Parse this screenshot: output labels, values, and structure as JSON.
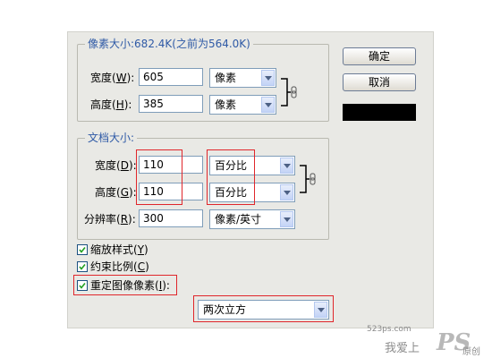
{
  "pixel_dimensions": {
    "title": "像素大小:682.4K(之前为564.0K)",
    "width": {
      "label_pre": "宽度(",
      "accel": "W",
      "label_post": "):",
      "value": "605",
      "unit": "像素"
    },
    "height": {
      "label_pre": "高度(",
      "accel": "H",
      "label_post": "):",
      "value": "385",
      "unit": "像素"
    }
  },
  "document_size": {
    "title": "文档大小:",
    "width": {
      "label_pre": "宽度(",
      "accel": "D",
      "label_post": "):",
      "value": "110",
      "unit": "百分比"
    },
    "height": {
      "label_pre": "高度(",
      "accel": "G",
      "label_post": "):",
      "value": "110",
      "unit": "百分比"
    },
    "resolution": {
      "label_pre": "分辨率(",
      "accel": "R",
      "label_post": "):",
      "value": "300",
      "unit": "像素/英寸"
    }
  },
  "buttons": {
    "ok": "确定",
    "cancel": "取消"
  },
  "options": {
    "scale_styles": {
      "label_pre": "缩放样式(",
      "accel": "Y",
      "label_post": ")",
      "checked": true
    },
    "constrain": {
      "label_pre": "约束比例(",
      "accel": "C",
      "label_post": ")",
      "checked": true
    },
    "resample": {
      "label_pre": "重定图像像素(",
      "accel": "I",
      "label_post": "):",
      "checked": true
    }
  },
  "resample_method": "两次立方",
  "watermark": {
    "site": "523ps.com",
    "main": "我爱上",
    "logo": "PS",
    "tail": "原创"
  },
  "colors": {
    "highlight": "#e0262b",
    "group_title": "#2f5aa6",
    "swatch": "#000000"
  }
}
